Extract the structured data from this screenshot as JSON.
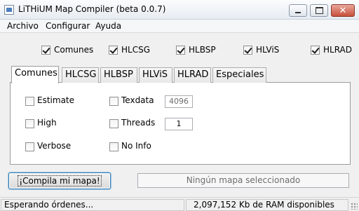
{
  "window": {
    "title": "LiTHiUM Map Compiler (beta 0.0.7)"
  },
  "menu": [
    "Archivo",
    "Configurar",
    "Ayuda"
  ],
  "stage_checkboxes": [
    {
      "label": "Comunes",
      "checked": true
    },
    {
      "label": "HLCSG",
      "checked": true
    },
    {
      "label": "HLBSP",
      "checked": true
    },
    {
      "label": "HLViS",
      "checked": true
    },
    {
      "label": "HLRAD",
      "checked": true
    }
  ],
  "tabs": [
    "Comunes",
    "HLCSG",
    "HLBSP",
    "HLViS",
    "HLRAD",
    "Especiales"
  ],
  "active_tab": "Comunes",
  "options": {
    "estimate": {
      "label": "Estimate",
      "checked": false
    },
    "high": {
      "label": "High",
      "checked": false
    },
    "verbose": {
      "label": "Verbose",
      "checked": false
    },
    "texdata": {
      "label": "Texdata",
      "checked": false,
      "value": "4096"
    },
    "threads": {
      "label": "Threads",
      "checked": false,
      "value": "1"
    },
    "noinfo": {
      "label": "No Info",
      "checked": false
    }
  },
  "compile_button": "¡Compila mi mapa!",
  "map_status": "Ningún mapa seleccionado",
  "statusbar": {
    "left": "Esperando órdenes...",
    "right": "2,097,152 Kb de RAM disponibles"
  }
}
